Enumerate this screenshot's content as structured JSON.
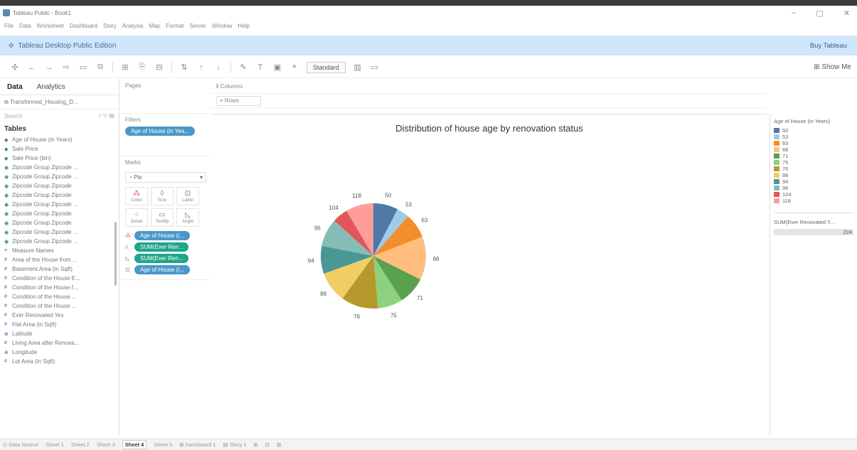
{
  "window": {
    "title": "Tableau Public - Book1",
    "controls": [
      "–",
      "▢",
      "✕"
    ]
  },
  "menu": [
    "File",
    "Data",
    "Worksheet",
    "Dashboard",
    "Story",
    "Analysis",
    "Map",
    "Format",
    "Server",
    "Window",
    "Help"
  ],
  "banner": {
    "title": "Tableau Desktop Public Edition",
    "buy": "Buy Tableau"
  },
  "toolbar": {
    "fit": "Standard",
    "show_me": "Show Me"
  },
  "data_pane": {
    "tabs": [
      "Data",
      "Analytics"
    ],
    "datasource": "Transformed_Housing_D...",
    "search_placeholder": "Search",
    "tables_header": "Tables",
    "fields": [
      "Age of House (in Years)",
      "Sale Price",
      "Sale Price (bin)",
      "Zipcode Group Zipcode ...",
      "Zipcode Group Zipcode ...",
      "Zipcode Group Zipcode",
      "Zipcode Group Zipcode",
      "Zipcode Group Zipcode ...",
      "Zipcode Group Zipcode",
      "Zipcode Group Zipcode",
      "Zipcode Group Zipcode ...",
      "Zipcode Group Zipcode ...",
      "Measure Names",
      "Area of the House from ...",
      "Basement Area (in Sqft)",
      "Condition of the House E...",
      "Condition of the House f...",
      "Condition of the House ...",
      "Condition of the House ...",
      "Ever Renovated Yes",
      "Flat Area (in Sqft)",
      "Latitude",
      "Living Area after Renova...",
      "Longitude",
      "Lot Area (in Sqft)"
    ]
  },
  "shelves": {
    "pages": "Pages",
    "filters": "Filters",
    "filter_pill": "Age of House (in Yea...",
    "marks": "Marks",
    "mark_type": "Pie",
    "mark_buttons": [
      "Color",
      "Size",
      "Label",
      "Detail",
      "Tooltip",
      "Angle"
    ],
    "mark_pills": [
      "Age of House (i...",
      "SUM(Ever Ren...",
      "SUM(Ever Ren...",
      "Age of House (i..."
    ],
    "columns": "Columns",
    "rows": "Rows"
  },
  "chart_data": {
    "type": "pie",
    "title": "Distribution of house age by renovation status",
    "categories": [
      "50",
      "53",
      "63",
      "68",
      "71",
      "75",
      "76",
      "88",
      "94",
      "96",
      "104",
      "118"
    ],
    "values": [
      8,
      4,
      8,
      14,
      9,
      8,
      12,
      10,
      9,
      9,
      5,
      9
    ],
    "colors": [
      "#4e79a7",
      "#a0cbe8",
      "#f28e2b",
      "#ffbe7d",
      "#59a14f",
      "#8cd17d",
      "#b6992d",
      "#f1ce63",
      "#499894",
      "#86bcb6",
      "#e15759",
      "#ff9d9a"
    ]
  },
  "legend": {
    "title": "Age of House (in Years)",
    "size_title": "SUM(Ever Renovated Y...",
    "size_value": "224"
  },
  "sheet_tabs": [
    "Data Source",
    "Sheet 1",
    "Sheet 2",
    "Sheet 3",
    "Sheet 4",
    "Sheet 5",
    "Dashboard 1",
    "Story 1"
  ],
  "active_sheet": "Sheet 4"
}
